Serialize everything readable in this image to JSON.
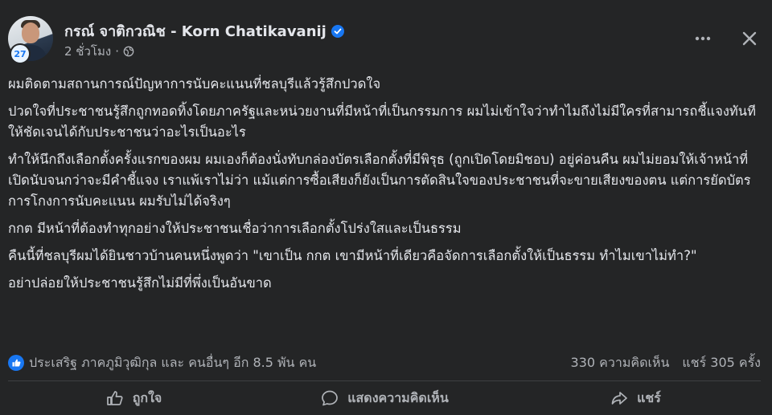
{
  "post": {
    "author": "กรณ์ จาติกวณิช - Korn Chatikavanij",
    "avatar_badge": "27",
    "time": "2 ชั่วโมง",
    "separator": "·",
    "paragraphs": [
      "ผมติดตามสถานการณ์ปัญหาการนับคะแนนที่ชลบุรีแล้วรู้สึกปวดใจ",
      "ปวดใจที่ประชาชนรู้สึกถูกทอดทิ้งโดยภาครัฐและหน่วยงานที่มีหน้าที่เป็นกรรมการ ผมไม่เข้าใจว่าทำไมถึงไม่มีใครที่สามารถชี้แจงทันทีให้ชัดเจนได้กับประชาชนว่าอะไรเป็นอะไร",
      "ทำให้นึกถึงเลือกตั้งครั้งแรกของผม ผมเองก็ต้องนั่งทับกล่องบัตรเลือกตั้งที่มีพิรุธ (ถูกเปิดโดยมิชอบ) อยู่ค่อนคืน ผมไม่ยอมให้เจ้าหน้าที่เปิดนับจนกว่าจะมีคำชี้แจง เราแพ้เราไม่ว่า แม้แต่การซื้อเสียงก็ยังเป็นการตัดสินใจของประชาชนที่จะขายเสียงของตน แต่การยัดบัตร การโกงการนับคะแนน ผมรับไม่ได้จริงๆ",
      "กกต มีหน้าที่ต้องทำทุกอย่างให้ประชาชนเชื่อว่าการเลือกตั้งโปร่งใสและเป็นธรรม",
      "คืนนี้ที่ชลบุรีผมได้ยินชาวบ้านคนหนึ่งพูดว่า \"เขาเป็น กกต เขามีหน้าที่เดียวคือจัดการเลือกตั้งให้เป็นธรรม ทำไมเขาไม่ทำ?\"",
      "อย่าปล่อยให้ประชาชนรู้สึกไม่มีที่พึ่งเป็นอันขาด"
    ],
    "reactions_text": "ประเสริฐ ภาคภูมิวุฒิกุล และ คนอื่นๆ อีก 8.5 พัน คน",
    "comments": "330 ความคิดเห็น",
    "shares": "แชร์ 305 ครั้ง"
  },
  "actions": {
    "like": "ถูกใจ",
    "comment": "แสดงความคิดเห็น",
    "share": "แชร์"
  },
  "icons": [
    "verified-badge-icon",
    "globe-icon",
    "more-icon",
    "close-icon",
    "like-reaction-icon",
    "thumbs-up-icon",
    "comment-bubble-icon",
    "share-arrow-icon"
  ],
  "colors": {
    "background": "#242526",
    "text": "#e4e6eb",
    "secondary": "#b0b3b8",
    "accent": "#1877f2"
  }
}
